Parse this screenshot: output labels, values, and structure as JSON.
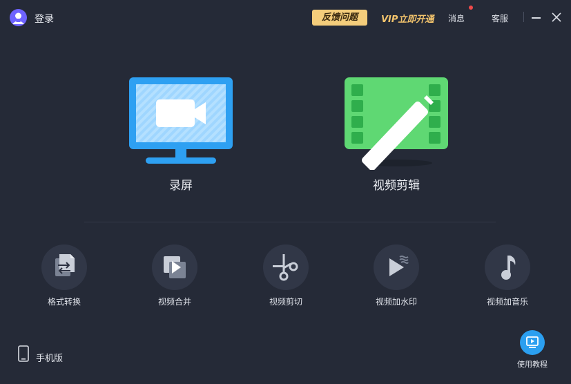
{
  "titlebar": {
    "login_label": "登录",
    "feedback_label": "反馈问题",
    "vip_label": "VIP立即开通",
    "message_label": "消息",
    "service_label": "客服"
  },
  "main": {
    "record_label": "录屏",
    "edit_label": "视频剪辑"
  },
  "tools": [
    {
      "label": "格式转换",
      "icon": "format-convert-icon"
    },
    {
      "label": "视频合并",
      "icon": "video-merge-icon"
    },
    {
      "label": "视频剪切",
      "icon": "scissors-icon"
    },
    {
      "label": "视频加水印",
      "icon": "watermark-icon"
    },
    {
      "label": "视频加音乐",
      "icon": "music-note-icon"
    }
  ],
  "footer": {
    "mobile_label": "手机版",
    "tutorial_label": "使用教程"
  },
  "colors": {
    "background": "#252a37",
    "accent_blue": "#2b9ff0",
    "accent_green": "#5fd873",
    "vip_gold": "#f3c46c",
    "notification_red": "#f04a4a"
  }
}
